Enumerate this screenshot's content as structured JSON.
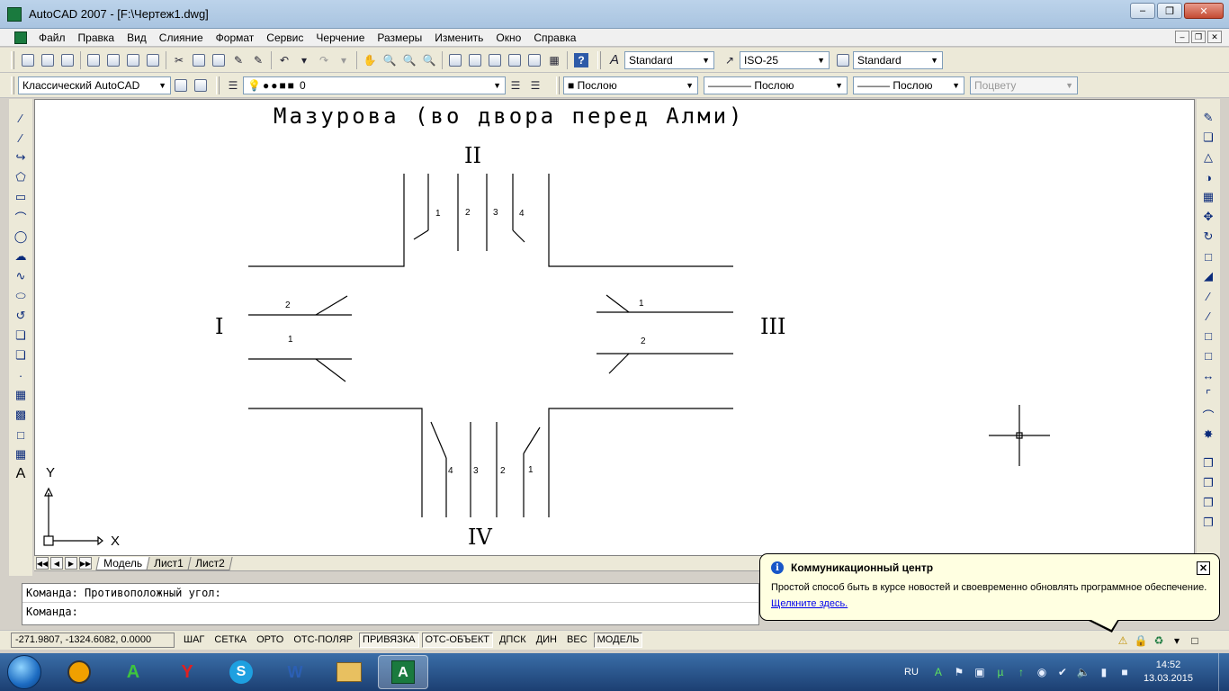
{
  "window": {
    "title": "AutoCAD 2007 - [F:\\Чертеж1.dwg]"
  },
  "menu": [
    "Файл",
    "Правка",
    "Вид",
    "Слияние",
    "Формат",
    "Сервис",
    "Черчение",
    "Размеры",
    "Изменить",
    "Окно",
    "Справка"
  ],
  "toolbar1": {
    "text_style": "Standard",
    "dim_style": "ISO-25",
    "table_style": "Standard"
  },
  "toolbar2": {
    "workspace": "Классический AutoCAD",
    "layer": "0",
    "color": "Послою",
    "linetype": "Послою",
    "lineweight": "Послою",
    "plotstyle": "Поцвету"
  },
  "drawing": {
    "title": "Мазурова (во двора перед Алми)",
    "roman": {
      "north": "II",
      "west": "I",
      "east": "III",
      "south": "IV"
    },
    "north_lanes": [
      "1",
      "2",
      "3",
      "4"
    ],
    "west_lanes": [
      "2",
      "1"
    ],
    "east_lanes": [
      "1",
      "2"
    ],
    "south_lanes": [
      "4",
      "3",
      "2",
      "1"
    ],
    "ucs": {
      "x": "X",
      "y": "Y"
    }
  },
  "layout_tabs": [
    "Модель",
    "Лист1",
    "Лист2"
  ],
  "command": {
    "line1": "Команда: Противоположный угол:",
    "line2": "Команда:"
  },
  "status": {
    "coords": "-271.9807, -1324.6082, 0.0000",
    "buttons": [
      {
        "label": "ШАГ",
        "on": false
      },
      {
        "label": "СЕТКА",
        "on": false
      },
      {
        "label": "ОРТО",
        "on": false
      },
      {
        "label": "ОТС-ПОЛЯР",
        "on": false
      },
      {
        "label": "ПРИВЯЗКА",
        "on": true
      },
      {
        "label": "ОТС-ОБЪЕКТ",
        "on": true
      },
      {
        "label": "ДПСК",
        "on": false
      },
      {
        "label": "ДИН",
        "on": false
      },
      {
        "label": "ВЕС",
        "on": false
      },
      {
        "label": "МОДЕЛЬ",
        "on": true
      }
    ]
  },
  "balloon": {
    "title": "Коммуникационный центр",
    "body": "Простой способ быть в курсе новостей и своевременно обновлять программное обеспечение.",
    "link": "Щелкните здесь."
  },
  "taskbar": {
    "lang": "RU",
    "time": "14:52",
    "date": "13.03.2015"
  }
}
